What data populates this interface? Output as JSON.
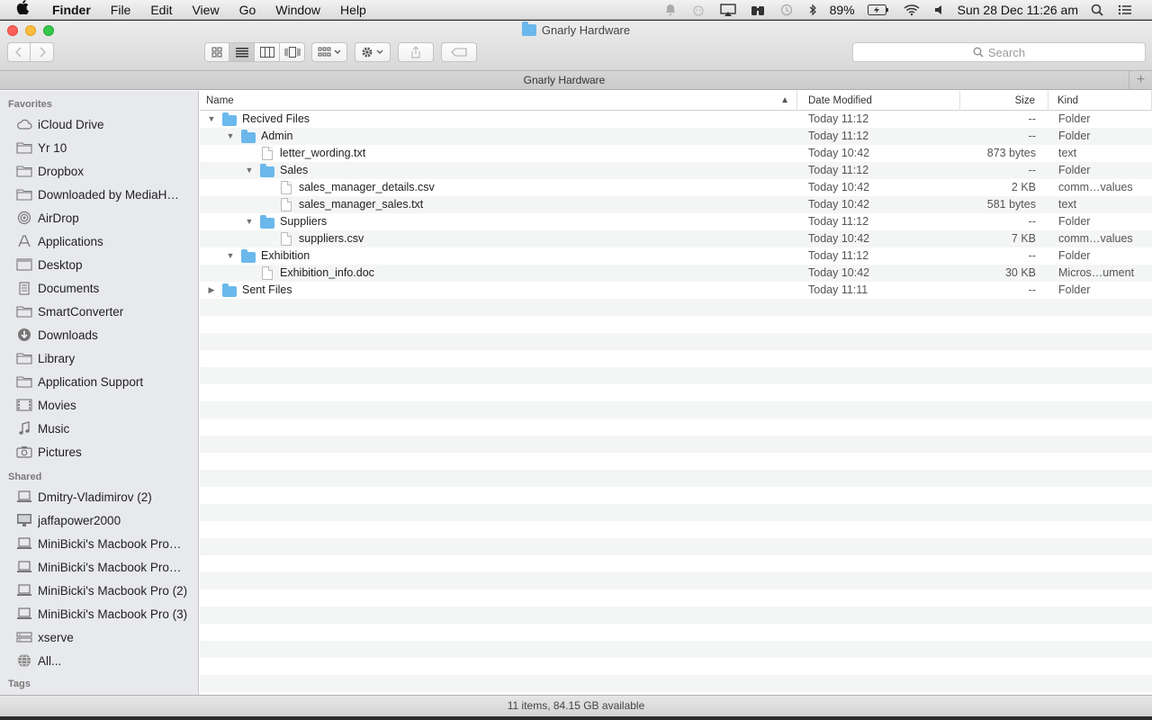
{
  "menubar": {
    "apple_icon": "apple-logo",
    "app_name": "Finder",
    "menus": [
      "File",
      "Edit",
      "View",
      "Go",
      "Window",
      "Help"
    ],
    "status": {
      "battery": "89%",
      "datetime": "Sun 28 Dec  11:26 am"
    }
  },
  "window": {
    "title": "Gnarly Hardware",
    "search_placeholder": "Search",
    "tab_label": "Gnarly Hardware",
    "tab_add": "+"
  },
  "sidebar": {
    "favorites_header": "Favorites",
    "favorites": [
      {
        "label": "iCloud Drive",
        "icon": "cloud-icon"
      },
      {
        "label": "Yr 10",
        "icon": "folder-icon"
      },
      {
        "label": "Dropbox",
        "icon": "folder-icon"
      },
      {
        "label": "Downloaded by MediaH…",
        "icon": "folder-icon"
      },
      {
        "label": "AirDrop",
        "icon": "airdrop-icon"
      },
      {
        "label": "Applications",
        "icon": "applications-icon"
      },
      {
        "label": "Desktop",
        "icon": "desktop-icon"
      },
      {
        "label": "Documents",
        "icon": "documents-icon"
      },
      {
        "label": "SmartConverter",
        "icon": "folder-icon"
      },
      {
        "label": "Downloads",
        "icon": "downloads-icon"
      },
      {
        "label": "Library",
        "icon": "folder-icon"
      },
      {
        "label": "Application Support",
        "icon": "folder-icon"
      },
      {
        "label": "Movies",
        "icon": "movies-icon"
      },
      {
        "label": "Music",
        "icon": "music-icon"
      },
      {
        "label": "Pictures",
        "icon": "pictures-icon"
      }
    ],
    "shared_header": "Shared",
    "shared": [
      {
        "label": "Dmitry-Vladimirov (2)",
        "icon": "computer-icon"
      },
      {
        "label": "jaffapower2000",
        "icon": "imac-icon"
      },
      {
        "label": "MiniBicki's Macbook Pro…",
        "icon": "computer-icon"
      },
      {
        "label": "MiniBicki's Macbook Pro…",
        "icon": "computer-icon"
      },
      {
        "label": "MiniBicki's Macbook Pro (2)",
        "icon": "computer-icon"
      },
      {
        "label": "MiniBicki's Macbook Pro (3)",
        "icon": "computer-icon"
      },
      {
        "label": "xserve",
        "icon": "server-icon"
      },
      {
        "label": "All...",
        "icon": "network-icon"
      }
    ],
    "tags_header": "Tags"
  },
  "columns": {
    "name": "Name",
    "date": "Date Modified",
    "size": "Size",
    "kind": "Kind"
  },
  "files": [
    {
      "name": "Recived Files",
      "date": "Today 11:12",
      "size": "--",
      "kind": "Folder"
    },
    {
      "name": "Admin",
      "date": "Today 11:12",
      "size": "--",
      "kind": "Folder"
    },
    {
      "name": "letter_wording.txt",
      "date": "Today 10:42",
      "size": "873 bytes",
      "kind": "text"
    },
    {
      "name": "Sales",
      "date": "Today 11:12",
      "size": "--",
      "kind": "Folder"
    },
    {
      "name": "sales_manager_details.csv",
      "date": "Today 10:42",
      "size": "2 KB",
      "kind": "comm…values"
    },
    {
      "name": "sales_manager_sales.txt",
      "date": "Today 10:42",
      "size": "581 bytes",
      "kind": "text"
    },
    {
      "name": "Suppliers",
      "date": "Today 11:12",
      "size": "--",
      "kind": "Folder"
    },
    {
      "name": "suppliers.csv",
      "date": "Today 10:42",
      "size": "7 KB",
      "kind": "comm…values"
    },
    {
      "name": "Exhibition",
      "date": "Today 11:12",
      "size": "--",
      "kind": "Folder"
    },
    {
      "name": "Exhibition_info.doc",
      "date": "Today 10:42",
      "size": "30 KB",
      "kind": "Micros…ument"
    },
    {
      "name": "Sent Files",
      "date": "Today 11:11",
      "size": "--",
      "kind": "Folder"
    }
  ],
  "statusbar": {
    "text": "11 items, 84.15 GB available"
  }
}
